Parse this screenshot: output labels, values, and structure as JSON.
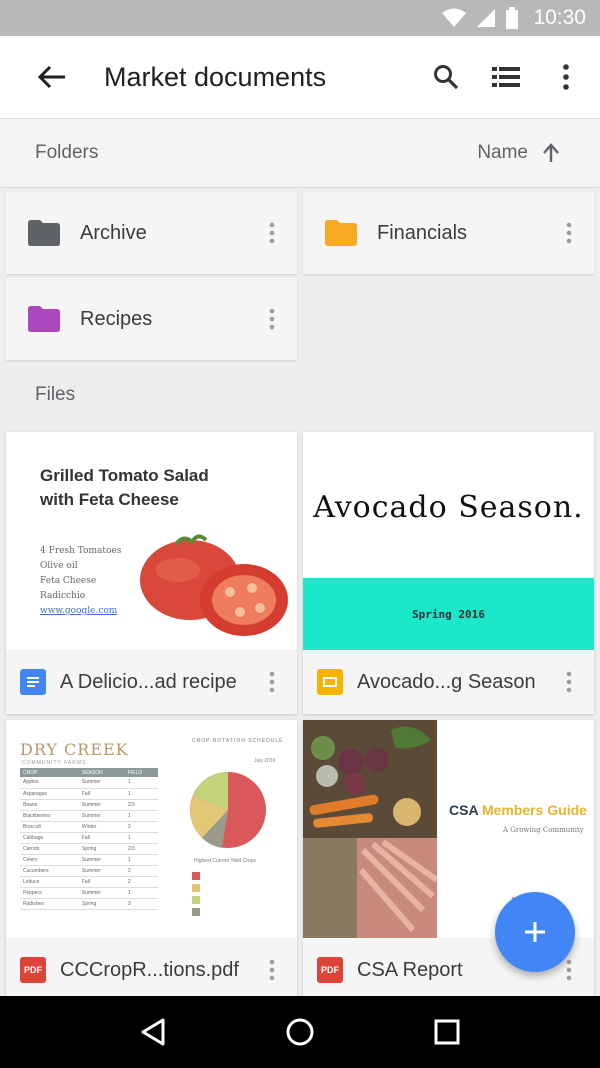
{
  "status_bar": {
    "time": "10:30"
  },
  "app_bar": {
    "title": "Market documents"
  },
  "sort_bar": {
    "section_label": "Folders",
    "sort_label": "Name"
  },
  "folders": [
    {
      "name": "Archive",
      "color": "#5f6368"
    },
    {
      "name": "Financials",
      "color": "#f9a825"
    },
    {
      "name": "Recipes",
      "color": "#ab47bc"
    }
  ],
  "files_label": "Files",
  "files": [
    {
      "name": "A Delicio...ad recipe",
      "type_icon": "google-docs-icon",
      "type_color": "#4285f4",
      "thumb": {
        "title": "Grilled Tomato Salad with Feta Cheese",
        "lines": [
          "4 Fresh Tomatoes",
          "Olive oil",
          "Feta Cheese",
          "Radicchio"
        ],
        "link": "www.google.com"
      }
    },
    {
      "name": "Avocado...g Season",
      "type_icon": "google-slides-icon",
      "type_color": "#f4b400",
      "thumb": {
        "title": "Avocado Season.",
        "band": "Spring 2016",
        "band_color": "#1ae8c8"
      }
    },
    {
      "name": "CCCropR...tions.pdf",
      "type_icon": "pdf-icon",
      "type_color": "#db4437",
      "thumb": {
        "title": "DRY CREEK",
        "subtitle": "COMMUNITY FARMS",
        "chart_heading": "CROP ROTATION SCHEDULE",
        "date": "July 2016",
        "table_headers": [
          "CROP",
          "SEASON",
          "FIELD"
        ],
        "table_rows": [
          [
            "Apples",
            "Summer",
            "1"
          ],
          [
            "Asparagus",
            "Fall",
            "1"
          ],
          [
            "Beans",
            "Summer",
            "2/3"
          ],
          [
            "Blackberries",
            "Summer",
            "1"
          ],
          [
            "Broccoli",
            "Winter",
            "3"
          ],
          [
            "Cabbage",
            "Fall",
            "1"
          ],
          [
            "Carrots",
            "Spring",
            "2/3"
          ],
          [
            "Celery",
            "Summer",
            "1"
          ],
          [
            "Cucumbers",
            "Summer",
            "2"
          ],
          [
            "Lettuce",
            "Fall",
            "2"
          ],
          [
            "Peppers",
            "Summer",
            "1"
          ],
          [
            "Radishes",
            "Spring",
            "3"
          ]
        ],
        "pie_subheading": "Highest Current Yield Crops"
      }
    },
    {
      "name": "CSA Report",
      "type_icon": "pdf-icon",
      "type_color": "#db4437",
      "thumb": {
        "title_part1": "CSA ",
        "title_part2": "Members Guide",
        "subtitle": "A Growing Community",
        "corner": "DRY CREEK"
      }
    }
  ],
  "fab": {
    "icon": "add-icon",
    "color": "#4285f4"
  },
  "nav": {
    "back": "nav-back-icon",
    "home": "nav-home-icon",
    "recents": "nav-recents-icon"
  }
}
